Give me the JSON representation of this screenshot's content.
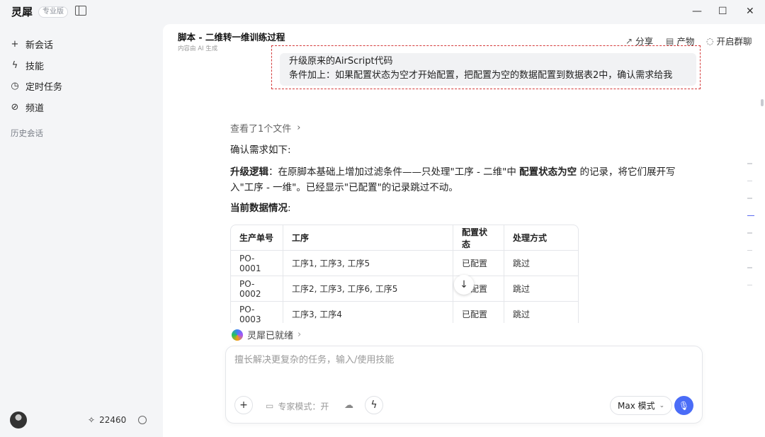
{
  "app": {
    "name": "灵犀",
    "edition": "专业版"
  },
  "sidebar": {
    "items": [
      {
        "icon": "plus-icon",
        "label": "新会话"
      },
      {
        "icon": "lightning-icon",
        "label": "技能"
      },
      {
        "icon": "clock-icon",
        "label": "定时任务"
      },
      {
        "icon": "channel-icon",
        "label": "频道"
      }
    ],
    "history_label": "历史会话",
    "points": "22460"
  },
  "header": {
    "title": "脚本 - 二维转一维训练过程",
    "subtitle": "内容由 AI 生成",
    "share": "分享",
    "artifacts": "产物",
    "group_chat": "开启群聊"
  },
  "user_message": {
    "line1": "升级原来的AirScript代码",
    "line2": "条件加上：如果配置状态为空才开始配置，把配置为空的数据配置到数据表2中，确认需求给我"
  },
  "assistant": {
    "file_viewed": "查看了1个文件",
    "confirm": "确认需求如下:",
    "upgrade_label": "升级逻辑",
    "upgrade_text_1": "：在原脚本基础上增加过滤条件——只处理\"工序 - 二维\"中",
    "upgrade_bold": "配置状态为空",
    "upgrade_text_2": "的记录，将它们展开写入\"工序 - 一维\"。已经显示\"已配置\"的记录跳过不动。",
    "current_label": "当前数据情况",
    "current_suffix": ":",
    "table": {
      "headers": [
        "生产单号",
        "工序",
        "配置状态",
        "处理方式"
      ],
      "rows": [
        [
          "PO-0001",
          "工序1, 工序3, 工序5",
          "已配置",
          "跳过"
        ],
        [
          "PO-0002",
          "工序2, 工序3, 工序6, 工序5",
          "已配置",
          "跳过"
        ],
        [
          "PO-0003",
          "工序3, 工序4",
          "已配置",
          "跳过"
        ]
      ]
    }
  },
  "status": {
    "ready": "灵犀已就绪"
  },
  "composer": {
    "placeholder": "擅长解决更复杂的任务，输入/使用技能",
    "expert_mode": "专家模式：开",
    "max_mode": "Max 模式"
  },
  "colors": {
    "accent": "#4a6cf7",
    "highlight_border": "#d43a3a"
  }
}
